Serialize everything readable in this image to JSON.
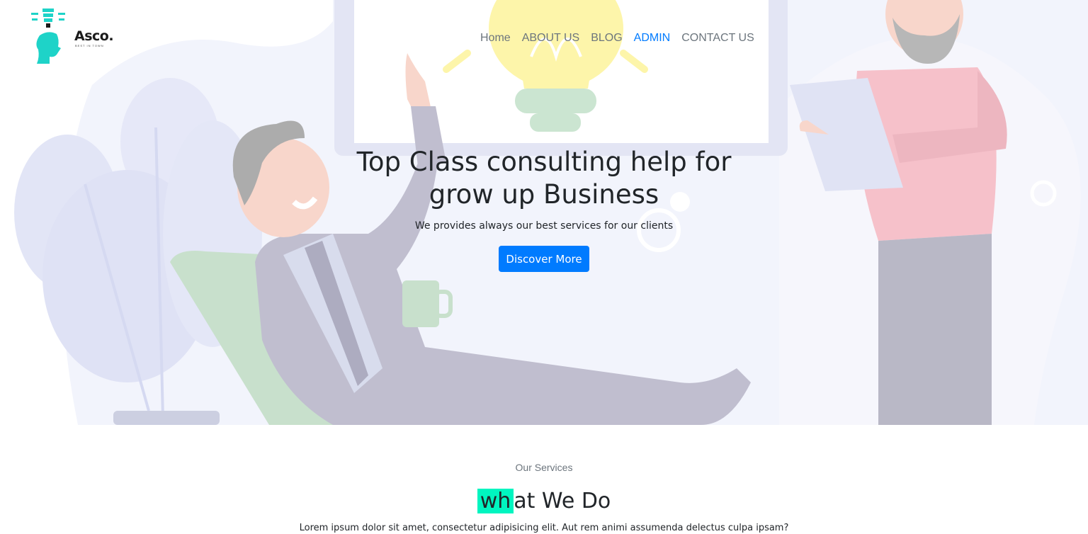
{
  "brand": {
    "name": "Asco.",
    "tagline": "BEST IN TOWN",
    "icon": "lightbulb-head-logo"
  },
  "nav": {
    "items": [
      {
        "label": "Home",
        "active": false
      },
      {
        "label": "ABOUT US",
        "active": false
      },
      {
        "label": "BLOG",
        "active": false
      },
      {
        "label": "ADMIN",
        "active": true
      },
      {
        "label": "CONTACT US",
        "active": false
      }
    ]
  },
  "hero": {
    "title_line1": "Top Class consulting help for",
    "title_line2": "grow up Business",
    "subtitle": "We provides always our best services for our clients",
    "button_label": "Discover More"
  },
  "services": {
    "label": "Our Services",
    "title_highlight": "wh",
    "title_rest": "at We Do",
    "description": "Lorem ipsum dolor sit amet, consectetur adipisicing elit. Aut rem animi assumenda delectus culpa ipsam?"
  },
  "colors": {
    "primary": "#007bff",
    "accent": "#00f5c0",
    "logo": "#1ed3c8"
  }
}
